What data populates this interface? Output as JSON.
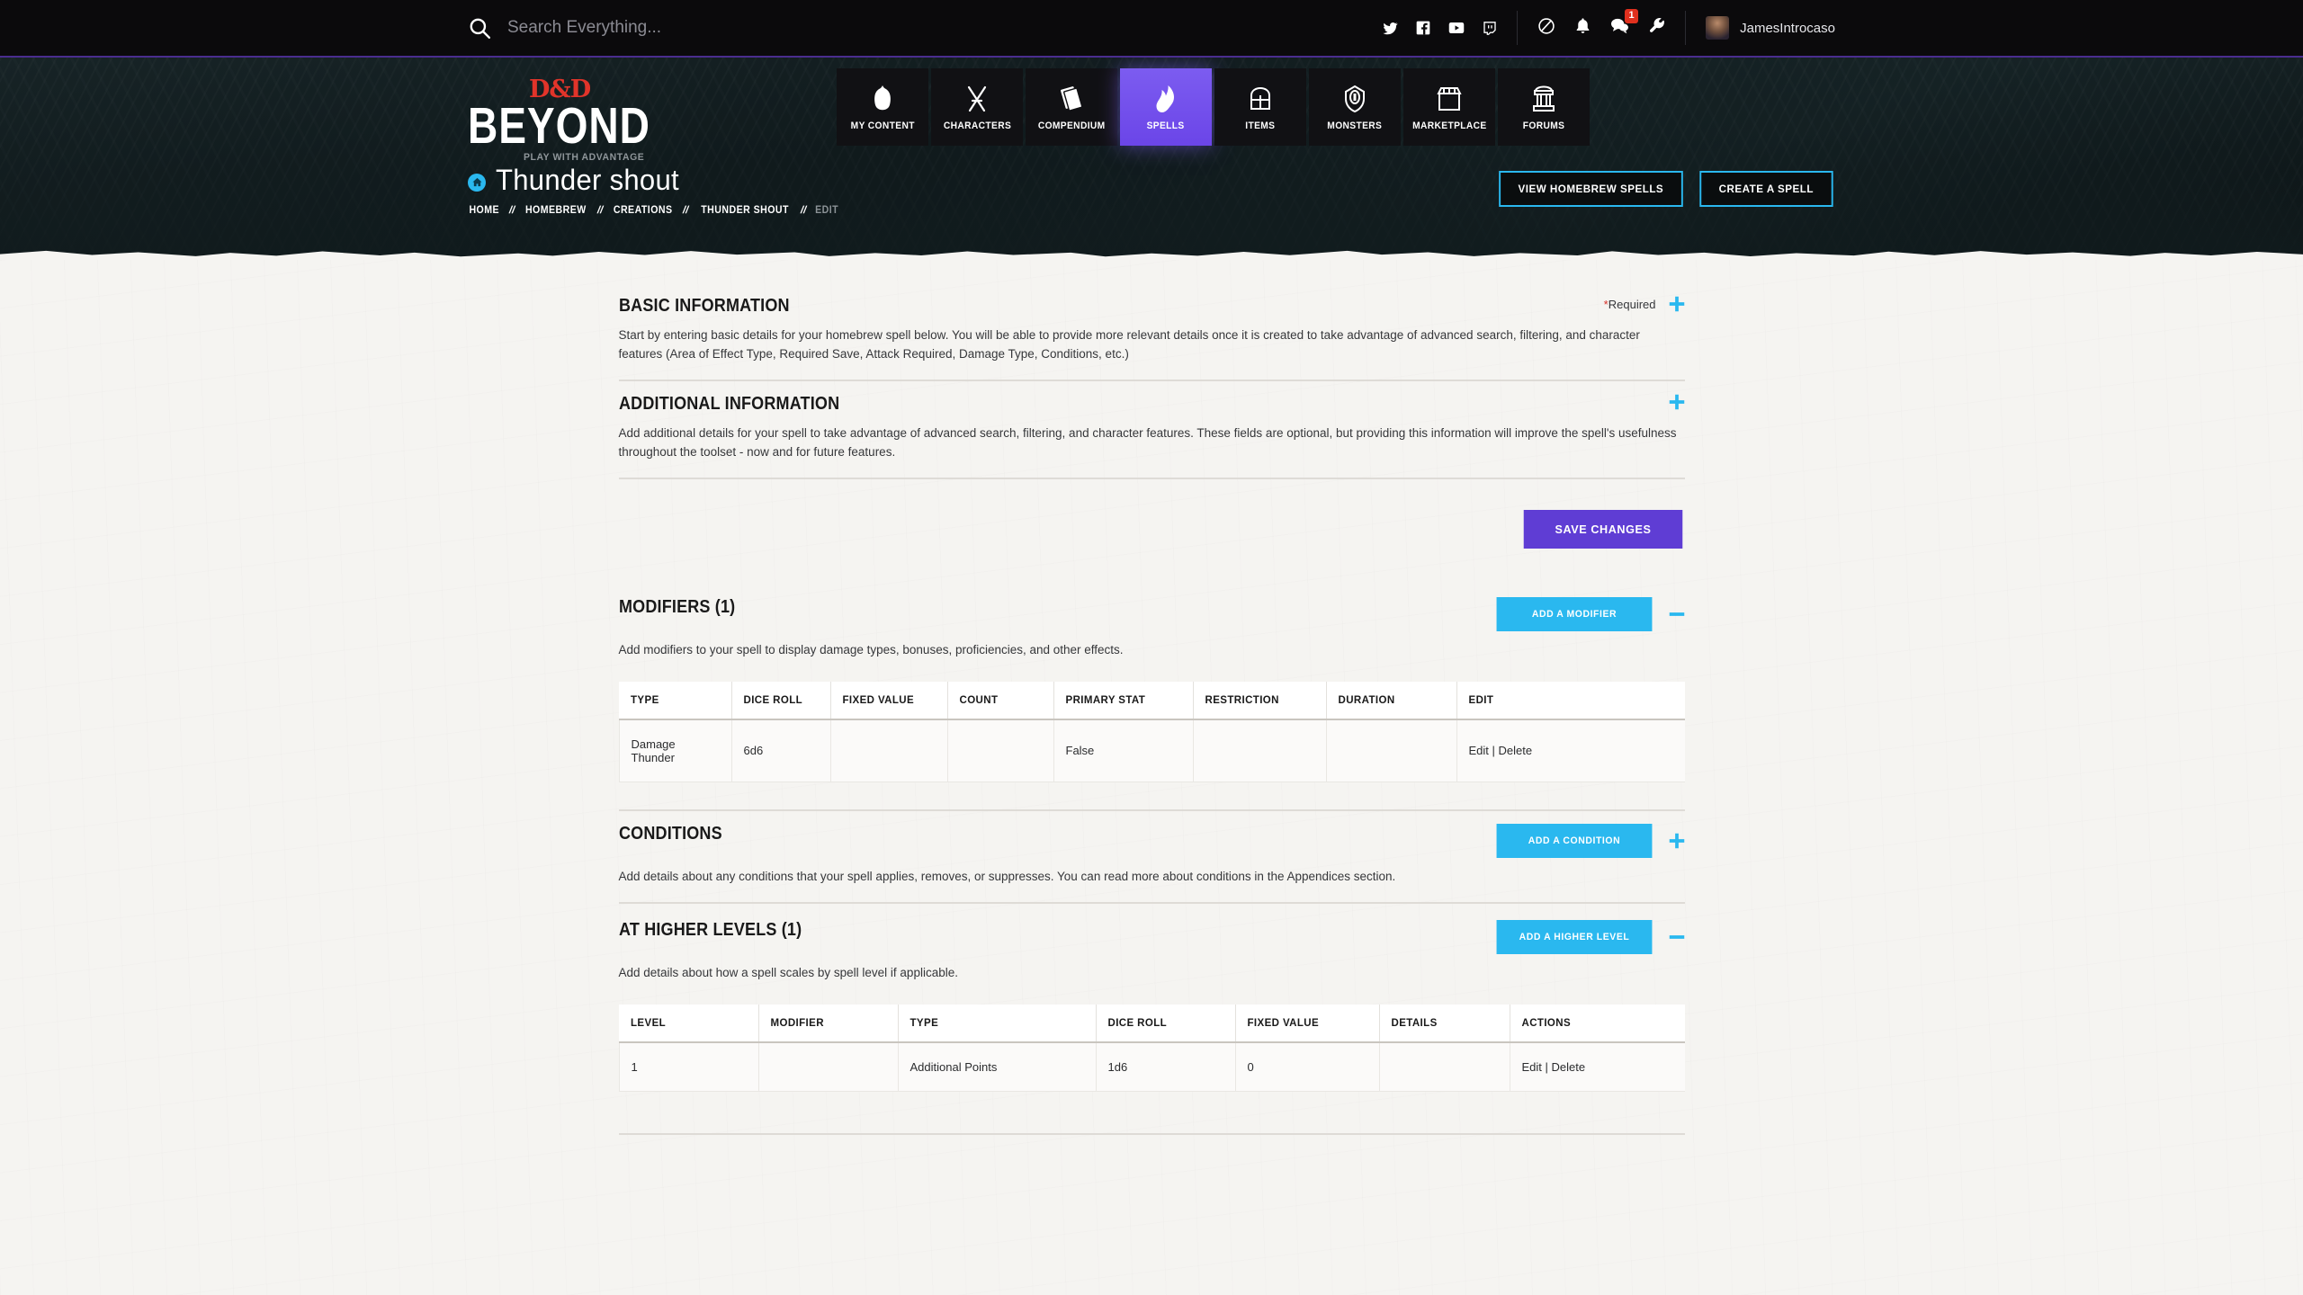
{
  "topbar": {
    "search_placeholder": "Search Everything...",
    "search_value": "",
    "search_icon": "search-icon",
    "social": [
      {
        "name": "twitter-icon",
        "label": "Twitter"
      },
      {
        "name": "facebook-icon",
        "label": "Facebook"
      },
      {
        "name": "youtube-icon",
        "label": "YouTube"
      },
      {
        "name": "twitch-icon",
        "label": "Twitch"
      }
    ],
    "tools": [
      {
        "name": "compass-icon",
        "label": "Explore"
      },
      {
        "name": "bell-icon",
        "label": "Notifications"
      },
      {
        "name": "chat-icon",
        "label": "Messages",
        "badge": "1"
      },
      {
        "name": "wrench-icon",
        "label": "Tools"
      }
    ],
    "user": {
      "name": "JamesIntrocaso",
      "avatar_name": "avatar"
    }
  },
  "brand": {
    "logo_dd": "D&D",
    "logo_beyond": "BEYOND",
    "tagline": "PLAY WITH ADVANTAGE"
  },
  "mainnav": {
    "items": [
      {
        "label": "MY CONTENT",
        "icon": "bag-icon",
        "active": false
      },
      {
        "label": "CHARACTERS",
        "icon": "crossed-swords-icon",
        "active": false
      },
      {
        "label": "COMPENDIUM",
        "icon": "books-icon",
        "active": false
      },
      {
        "label": "SPELLS",
        "icon": "flame-hand-icon",
        "active": true
      },
      {
        "label": "ITEMS",
        "icon": "chest-icon",
        "active": false
      },
      {
        "label": "MONSTERS",
        "icon": "eye-shield-icon",
        "active": false
      },
      {
        "label": "MARKETPLACE",
        "icon": "shop-icon",
        "active": false
      },
      {
        "label": "FORUMS",
        "icon": "column-icon",
        "active": false
      }
    ]
  },
  "hero": {
    "title": "Thunder shout",
    "home_icon": "home-icon",
    "breadcrumb": [
      {
        "label": "HOME",
        "current": false
      },
      {
        "label": "HOMEBREW",
        "current": false
      },
      {
        "label": "CREATIONS",
        "current": false
      },
      {
        "label": "THUNDER SHOUT",
        "current": false
      },
      {
        "label": "EDIT",
        "current": true
      }
    ],
    "separator": "//",
    "actions": [
      {
        "label": "VIEW HOMEBREW SPELLS",
        "name": "view-homebrew-spells-button"
      },
      {
        "label": "CREATE A SPELL",
        "name": "create-a-spell-button"
      }
    ]
  },
  "sections": {
    "basic": {
      "title": "BASIC INFORMATION",
      "description": "Start by entering basic details for your homebrew spell below. You will be able to provide more relevant details once it is created to take advantage of advanced search, filtering, and character features (Area of Effect Type, Required Save, Attack Required, Damage Type, Conditions, etc.)",
      "required_star": "*",
      "required_label": "Required",
      "toggle": "plus-icon"
    },
    "additional": {
      "title": "ADDITIONAL INFORMATION",
      "description": "Add additional details for your spell to take advantage of advanced search, filtering, and character features. These fields are optional, but providing this information will improve the spell's usefulness throughout the toolset - now and for future features.",
      "toggle": "plus-icon"
    },
    "save": {
      "label": "SAVE CHANGES"
    },
    "modifiers": {
      "title": "MODIFIERS (1)",
      "description": "Add modifiers to your spell to display damage types, bonuses, proficiencies, and other effects.",
      "add_label": "ADD A MODIFIER",
      "toggle": "minus-icon",
      "columns": [
        "TYPE",
        "DICE ROLL",
        "FIXED VALUE",
        "COUNT",
        "PRIMARY STAT",
        "RESTRICTION",
        "DURATION",
        "EDIT"
      ],
      "rows": [
        {
          "type": "Damage Thunder",
          "dice_roll": "6d6",
          "fixed_value": "",
          "count": "",
          "primary_stat": "False",
          "restriction": "",
          "duration": "",
          "edit": "Edit | Delete"
        }
      ]
    },
    "conditions": {
      "title": "CONDITIONS",
      "description": "Add details about any conditions that your spell applies, removes, or suppresses. You can read more about conditions in the Appendices section.",
      "add_label": "ADD A CONDITION",
      "toggle": "plus-icon"
    },
    "higher_levels": {
      "title": "AT HIGHER LEVELS (1)",
      "description": "Add details about how a spell scales by spell level if applicable.",
      "add_label": "ADD A HIGHER LEVEL",
      "toggle": "minus-icon",
      "columns": [
        "LEVEL",
        "MODIFIER",
        "TYPE",
        "DICE ROLL",
        "FIXED VALUE",
        "DETAILS",
        "ACTIONS"
      ],
      "rows": [
        {
          "level": "1",
          "modifier": "",
          "type": "Additional Points",
          "dice_roll": "1d6",
          "fixed_value": "0",
          "details": "",
          "actions": "Edit | Delete"
        }
      ]
    }
  },
  "colors": {
    "accent_cyan": "#2ab8ef",
    "accent_purple": "#5f3dd4",
    "brand_red": "#e1342a",
    "badge_red": "#e0301e",
    "nav_active": "#7c5cf0",
    "paper": "#f5f4f1",
    "dark": "#0b0a0c"
  }
}
